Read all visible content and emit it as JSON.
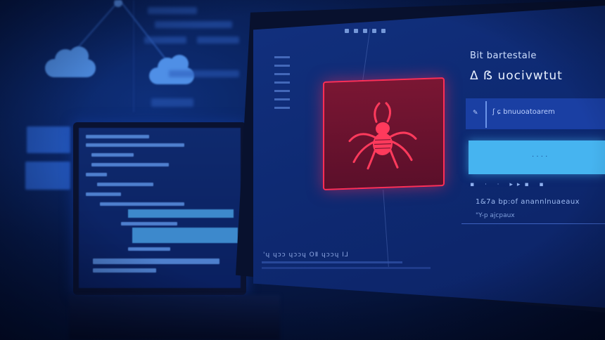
{
  "panel": {
    "title": "Bit bartestale",
    "heading": "Δ ẞ uocivwtut",
    "search_text": "ʃ  ɕ bnuuoatoarem",
    "bar_icon": "✎",
    "status_line": "1&7a  bp:of  anannlnuaeaux",
    "status_sub": "\"Y-p ajcpaux"
  },
  "footer": {
    "text": "'ɥ ɥɔɔ ɥɔɔɥ OⅡ ɥɔɔɥ  I⅃"
  },
  "icons": {
    "threat": "spider-icon",
    "cloud": "cloud-icon"
  },
  "colors": {
    "alert": "#ff2e55",
    "accent": "#46b4f0"
  }
}
